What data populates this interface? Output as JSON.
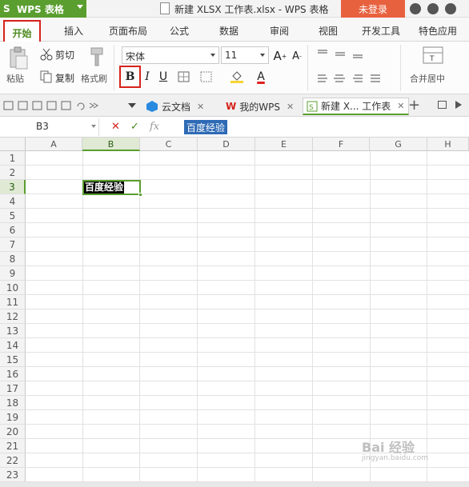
{
  "app": {
    "name": "WPS 表格",
    "title": "新建 XLSX 工作表.xlsx - WPS 表格",
    "login": "未登录"
  },
  "ribbon_tabs": [
    "开始",
    "插入",
    "页面布局",
    "公式",
    "数据",
    "审阅",
    "视图",
    "开发工具",
    "特色应用"
  ],
  "ribbon": {
    "cut": "剪切",
    "copy": "复制",
    "paste": "粘贴",
    "format_painter": "格式刷",
    "font_name": "宋体",
    "font_size": "11",
    "bold": "B",
    "italic": "I",
    "underline": "U",
    "merge": "合并居中"
  },
  "doc_tabs": [
    {
      "label": "云文档"
    },
    {
      "label": "我的WPS"
    },
    {
      "label": "新建 X... 工作表"
    }
  ],
  "formula_bar": {
    "name_box": "B3",
    "fx": "fx",
    "value": "百度经验"
  },
  "grid": {
    "columns": [
      "A",
      "B",
      "C",
      "D",
      "E",
      "F",
      "G",
      "H"
    ],
    "rows": [
      "1",
      "2",
      "3",
      "4",
      "5",
      "6",
      "7",
      "8",
      "9",
      "10",
      "11",
      "12",
      "13",
      "14",
      "15",
      "16",
      "17",
      "18",
      "19",
      "20",
      "21",
      "22",
      "23"
    ],
    "selected_column": "B",
    "selected_row": "3",
    "cell_B3": "百度经验"
  },
  "watermark": {
    "brand": "Bai 经验",
    "url": "jingyan.baidu.com"
  }
}
